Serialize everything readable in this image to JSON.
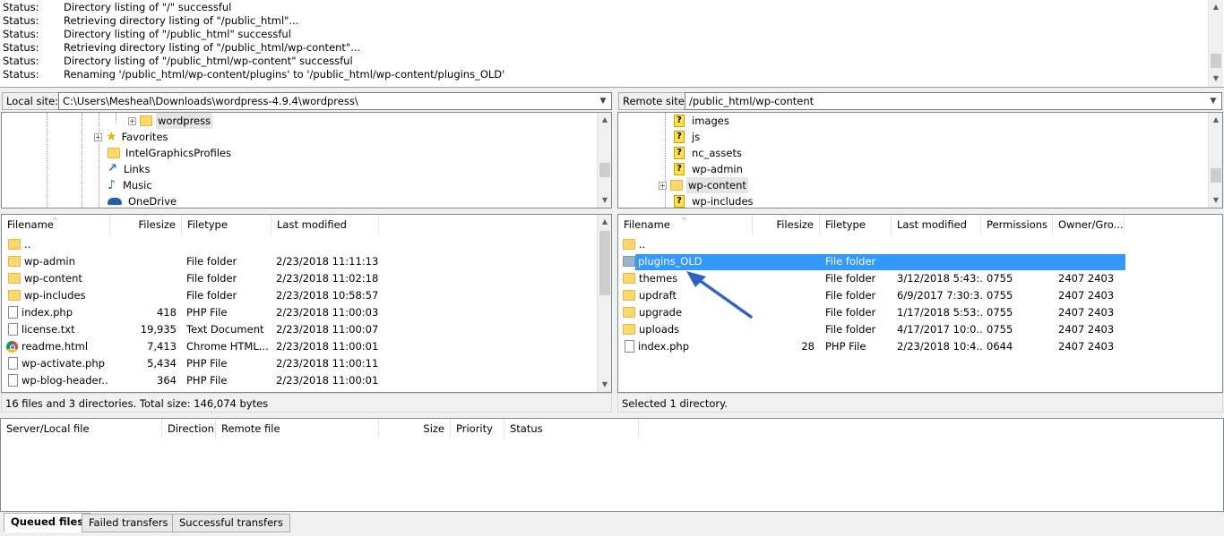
{
  "log": {
    "rows": [
      {
        "status": "Status:",
        "message": "Directory listing of \"/\" successful"
      },
      {
        "status": "Status:",
        "message": "Retrieving directory listing of \"/public_html\"..."
      },
      {
        "status": "Status:",
        "message": "Directory listing of \"/public_html\" successful"
      },
      {
        "status": "Status:",
        "message": "Retrieving directory listing of \"/public_html/wp-content\"..."
      },
      {
        "status": "Status:",
        "message": "Directory listing of \"/public_html/wp-content\" successful"
      },
      {
        "status": "Status:",
        "message": "Renaming '/public_html/wp-content/plugins' to '/public_html/wp-content/plugins_OLD'"
      }
    ]
  },
  "local": {
    "site_label": "Local site:",
    "path": "C:\\Users\\Mesheal\\Downloads\\wordpress-4.9.4\\wordpress\\",
    "tree": [
      "wordpress",
      "Favorites",
      "IntelGraphicsProfiles",
      "Links",
      "Music",
      "OneDrive"
    ],
    "columns": [
      "Filename",
      "Filesize",
      "Filetype",
      "Last modified"
    ],
    "files": [
      {
        "name": "..",
        "size": "",
        "type": "",
        "modified": "",
        "icon": "folder-icon"
      },
      {
        "name": "wp-admin",
        "size": "",
        "type": "File folder",
        "modified": "2/23/2018 11:11:13...",
        "icon": "folder-icon"
      },
      {
        "name": "wp-content",
        "size": "",
        "type": "File folder",
        "modified": "2/23/2018 11:02:18...",
        "icon": "folder-icon"
      },
      {
        "name": "wp-includes",
        "size": "",
        "type": "File folder",
        "modified": "2/23/2018 10:58:57...",
        "icon": "folder-icon"
      },
      {
        "name": "index.php",
        "size": "418",
        "type": "PHP File",
        "modified": "2/23/2018 11:00:03...",
        "icon": "file-icon"
      },
      {
        "name": "license.txt",
        "size": "19,935",
        "type": "Text Document",
        "modified": "2/23/2018 11:00:07...",
        "icon": "file-icon"
      },
      {
        "name": "readme.html",
        "size": "7,413",
        "type": "Chrome HTML...",
        "modified": "2/23/2018 11:00:01...",
        "icon": "chrome-icon"
      },
      {
        "name": "wp-activate.php",
        "size": "5,434",
        "type": "PHP File",
        "modified": "2/23/2018 11:00:11...",
        "icon": "file-icon"
      },
      {
        "name": "wp-blog-header...",
        "size": "364",
        "type": "PHP File",
        "modified": "2/23/2018 11:00:01...",
        "icon": "file-icon"
      }
    ],
    "status": "16 files and 3 directories. Total size: 146,074 bytes"
  },
  "remote": {
    "site_label": "Remote site:",
    "path": "/public_html/wp-content",
    "tree": [
      "images",
      "js",
      "nc_assets",
      "wp-admin",
      "wp-content",
      "wp-includes"
    ],
    "columns": [
      "Filename",
      "Filesize",
      "Filetype",
      "Last modified",
      "Permissions",
      "Owner/Gro..."
    ],
    "files": [
      {
        "name": "..",
        "size": "",
        "type": "",
        "modified": "",
        "perms": "",
        "owner": "",
        "icon": "folder-icon"
      },
      {
        "name": "plugins_OLD",
        "size": "",
        "type": "File folder",
        "modified": "",
        "perms": "",
        "owner": "",
        "icon": "folder-icon",
        "selected": true
      },
      {
        "name": "themes",
        "size": "",
        "type": "File folder",
        "modified": "3/12/2018 5:43:...",
        "perms": "0755",
        "owner": "2407 2403",
        "icon": "folder-icon"
      },
      {
        "name": "updraft",
        "size": "",
        "type": "File folder",
        "modified": "6/9/2017 7:30:3...",
        "perms": "0755",
        "owner": "2407 2403",
        "icon": "folder-icon"
      },
      {
        "name": "upgrade",
        "size": "",
        "type": "File folder",
        "modified": "1/17/2018 5:53:...",
        "perms": "0755",
        "owner": "2407 2403",
        "icon": "folder-icon"
      },
      {
        "name": "uploads",
        "size": "",
        "type": "File folder",
        "modified": "4/17/2017 10:0...",
        "perms": "0755",
        "owner": "2407 2403",
        "icon": "folder-icon"
      },
      {
        "name": "index.php",
        "size": "28",
        "type": "PHP File",
        "modified": "2/23/2018 10:4...",
        "perms": "0644",
        "owner": "2407 2403",
        "icon": "file-icon"
      }
    ],
    "status": "Selected 1 directory."
  },
  "queue": {
    "columns": [
      "Server/Local file",
      "Direction",
      "Remote file",
      "Size",
      "Priority",
      "Status"
    ]
  },
  "tabs": [
    "Queued files",
    "Failed transfers",
    "Successful transfers"
  ],
  "colors": {
    "selection": "#3399ff",
    "arrow": "#2e63c4",
    "folder": "#fcd869"
  }
}
